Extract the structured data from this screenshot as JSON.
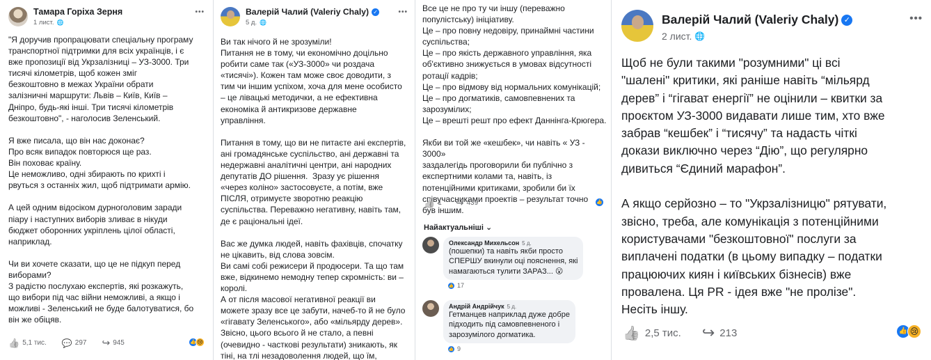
{
  "p1": {
    "author": "Тамара Горіха Зерня",
    "time": "1 лист.",
    "text": "\"Я доручив пропрацювати спеціальну програму\nтранспортної підтримки для всіх українців, і є\nвже пропозиції від Укрзалізниці – УЗ-3000. Три\nтисячі кілометрів, щоб кожен зміг\nбезкоштовно в межах України обрати\nзалізничні маршрути: Львів – Київ, Київ –\nДніпро, будь-які інші. Три тисячі кілометрів\nбезкоштовно\", - наголосив Зеленський.\n\nЯ вже писала, що він нас доконає?\nПро всяк випадок повторюся ще раз.\nВін поховає країну.\nЦе неможливо, одні збирають по крихті і\nрвуться з останніх жил, щоб підтримати армію.\n\nА цей одним відосіком дурноголовим заради\nпіару і наступних виборів зливає в нікуди\nбюджет оборонних укріплень цілої області,\nнаприклад.\n\nЧи ви хочете сказати, що це не підкуп перед\nвиборами?\nЗ радістю послухаю експертів, які розкажуть,\nщо вибори під час війни неможливі, а якщо і\nможливі - Зеленський не буде балотуватися, бо\nвін же обіцяв.",
    "likes": "5,1 тис.",
    "comments": "297",
    "shares": "945"
  },
  "p2": {
    "author": "Валерій Чалий (Valeriy Chaly)",
    "time": "5 д.",
    "text": "Ви так нічого й не зрозуміли!\nПитання не в тому, чи економічно доцільно\nробити саме так («УЗ-3000» чи роздача\n«тисячі»). Кожен там може своє доводити, з\nтим чи іншим успіхом, хоча для мене особисто\n– це лівацькі методички, а не ефективна\nекономіка й антикризове державне\nуправління.\n\nПитання в тому, що ви не питаєте ані експертів,\nані громадянське суспільство, ані державні та\nнедержавні аналітичні центри, ані народних\nдепутатів ДО рішення.  Зразу ує рішення\n«через коліно» застосовуєте, а потім, вже\nПІСЛЯ, отримуєте зворотню реакцію\nсуспільства. Переважно негативну, навіть там,\nде є раціональні ідеї.\n\nВас же думка людей, навіть фахівців, спочатку\nне цікавить, від слова зовсім.\nВи самі собі режисери й продюсери. Та що там\nвже, відкинемо немодну тепер скромність: ви –\nкоролі.\nА от після масової негативної реакції ви\nможете зразу все це забути, начеб-то й не було\n«гігавату Зеленського», або «мільярду дерев».\nЗвісно, цього всього й не стало, а певні\n(очевидно - часткові результати) зникають, як\nтіні, на тлі незадоволення людей, що їм,\nфактично, набрехали."
  },
  "p3": {
    "text": "Все це не про ту чи іншу (переважно\nпопулістську) ініціативу.\nЦе – про повну недовіру, принаймні частини\nсуспільства;\nЦе – про якість державного управління, яка\nоб'єктивно знижується в умовах відсутності\nротації кадрів;\nЦе – про відмову від нормальних комунікацій;\nЦе – про догматиків, самовпевнених та\nзарозумілих;\nЦе – врешті решт про ефект Даннінга-Крюгера.\n\nЯкби ви той же «кешбек», чи навіть « УЗ - 3000»\nзаздалегідь проговорили би публічно з\nекспертними колами та, навіть, із\nпотенційними критиками, зробили би їх\nспівучасниками проектів – результат точно\nбув іншим.",
    "likes": "1",
    "shares": "439",
    "sort_label": "Найактуальніші",
    "comments": [
      {
        "author": "Олександр Михельсон",
        "time": "5 д.",
        "text": "(пошепки) та навіть якби просто\nСПЕРШУ вкинули оці пояснення, які\nнамагаються тулити ЗАРАЗ... 😮",
        "likes": "17"
      },
      {
        "author": "Андрій Андрійчук",
        "time": "5 д.",
        "text": "Гетманцев наприклад дуже добре\nпідходить під самовпевненого і\nзарозумілого догматика.",
        "likes": "9"
      }
    ]
  },
  "p4": {
    "author": "Валерій Чалий (Valeriy Chaly)",
    "time": "2 лист.",
    "text": "Щоб не були такими \"розумними\" ці всі\n\"шалені\" критики, які раніше навіть “мільярд\nдерев” і “гігават енергії” не оцінили – квитки за\nпроєктом УЗ-3000 видавати лише тим, хто вже\nзабрав “кешбек” і “тисячу” та надасть чіткі\nдокази виключно через “Дію”, що регулярно\nдивиться “Єдиний марафон”.\n\nА якщо серйозно – то \"Укрзалізницю\" рятувати,\nзвісно, треба, але комунікація з потенційними\nкористувачами \"безкоштовної\" послуги за\nвиплачені податки (в цьому випадку – податки\nпрацюючих киян і київських бізнесів) вже\nпровалена. Ця PR - ідея вже \"не пролізе\".\nНесіть іншу.",
    "likes": "2,5 тис.",
    "shares": "213"
  },
  "icons": {
    "more": "•••",
    "verified": "✓",
    "like": "👍",
    "globe": "🌐",
    "comment": "💬",
    "share": "↪",
    "sad": "😢",
    "chevron": "⌄"
  },
  "colors": {
    "facebook_blue": "#1877f2",
    "meta_gray": "#65676b"
  }
}
